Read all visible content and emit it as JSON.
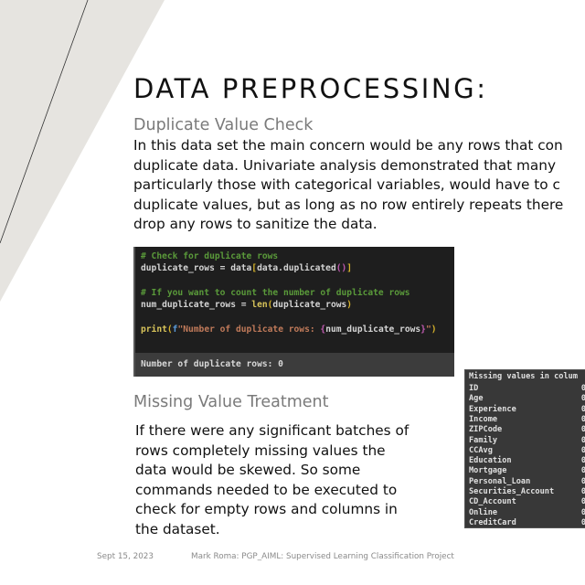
{
  "slide": {
    "title": "DATA PREPROCESSING:",
    "section1": {
      "heading": "Duplicate Value Check",
      "paragraph_lines": [
        "In this data set the main concern would be any rows that con",
        "duplicate data. Univariate analysis demonstrated that many",
        "particularly those with categorical variables, would have to c",
        "duplicate values, but as long as no row entirely repeats there",
        "drop any rows to sanitize the data."
      ]
    },
    "code_cell": {
      "lines": [
        {
          "comment": "# Check for duplicate rows"
        },
        {
          "pre": "duplicate_rows = data",
          "b1": "[",
          "mid": "data.duplicated",
          "b2": "()",
          "b3": "]"
        },
        {
          "blank": ""
        },
        {
          "comment": "# If you want to count the number of duplicate rows"
        },
        {
          "pre": "num_duplicate_rows = ",
          "fn": "len",
          "b1": "(",
          "mid": "duplicate_rows",
          "b3": ")"
        },
        {
          "blank": ""
        },
        {
          "fn": "print",
          "b1": "(",
          "fprefix": "f",
          "str": "\"Number of duplicate rows: ",
          "brace_open": "{",
          "var": "num_duplicate_rows",
          "brace_close": "}",
          "str_end": "\"",
          "b3": ")"
        }
      ],
      "output": "Number of duplicate rows: 0"
    },
    "section2": {
      "heading": "Missing Value Treatment",
      "paragraph_lines": [
        "If there were any significant batches of",
        "rows completely missing values the",
        "data would be skewed. So some",
        "commands needed to be executed to",
        "check for empty rows and columns in",
        "the dataset."
      ]
    },
    "missing_values": {
      "header": "Missing values in colum",
      "rows": [
        {
          "name": "ID",
          "value": "0"
        },
        {
          "name": "Age",
          "value": "0"
        },
        {
          "name": "Experience",
          "value": "0"
        },
        {
          "name": "Income",
          "value": "0"
        },
        {
          "name": "ZIPCode",
          "value": "0"
        },
        {
          "name": "Family",
          "value": "0"
        },
        {
          "name": "CCAvg",
          "value": "0"
        },
        {
          "name": "Education",
          "value": "0"
        },
        {
          "name": "Mortgage",
          "value": "0"
        },
        {
          "name": "Personal_Loan",
          "value": "0"
        },
        {
          "name": "Securities_Account",
          "value": "0"
        },
        {
          "name": "CD_Account",
          "value": "0"
        },
        {
          "name": "Online",
          "value": "0"
        },
        {
          "name": "CreditCard",
          "value": "0"
        }
      ]
    },
    "footer": {
      "date": "Sept 15, 2023",
      "caption": "Mark Roma: PGP_AIML: Supervised Learning Classification Project"
    }
  },
  "colors": {
    "decor_gray": "#e6e4e0",
    "code_bg": "#1e1e1e",
    "output_bg": "#3c3c3c",
    "comment_green": "#5a9a3a",
    "heading_gray": "#7a7a7a"
  }
}
